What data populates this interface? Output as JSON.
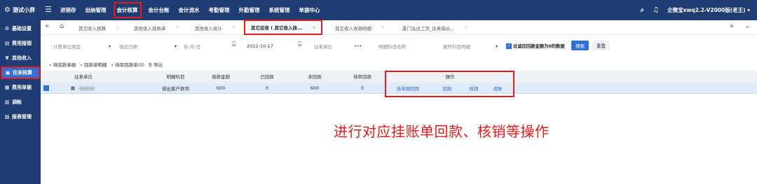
{
  "topbar": {
    "brand": "测试小屏",
    "menu_icon": "☰",
    "nav": [
      "进销存",
      "出纳管理",
      "会计核算",
      "会计台账",
      "会计流水",
      "考勤管理",
      "外勤管理",
      "系统管理",
      "单据中心"
    ],
    "search_icon": "⌕",
    "bell_icon": "♫",
    "user": "企微宝xwq2.2-V2000版(老王)",
    "user_arrow": "▾"
  },
  "sidebar": {
    "items": [
      {
        "icon": "⚙",
        "label": "基础设置"
      },
      {
        "icon": "▤",
        "label": "费用报销"
      },
      {
        "icon": "¥",
        "label": "其他收入"
      },
      {
        "icon": "▣",
        "label": "往来核算"
      },
      {
        "icon": "▦",
        "label": "费用单据"
      },
      {
        "icon": "▥",
        "label": "调帐"
      },
      {
        "icon": "▧",
        "label": "报表管理"
      }
    ]
  },
  "tabs": {
    "prev": "«",
    "home": "⌂",
    "items": [
      "其它收入核算",
      "其他收入挂账单",
      "其他收入统计",
      "其它应收 ( 其它收入挂...",
      "其它收入收款明细",
      "厦门泓达工贸_往来借出..."
    ],
    "close": "×",
    "next": "»",
    "down": "⌄"
  },
  "filters": {
    "unit_type": "计费单位类型",
    "date_type": "借出日期",
    "date_fmt": "年-月-日",
    "date_value": "2022-10-17",
    "unit": "往来单位",
    "dots": "•••",
    "subject": "明细科目名称",
    "show_subject": "展开科目明细",
    "checkbox_label": "过滤应回款金额为0的数据",
    "check": "✓",
    "arrow": "▾",
    "calendar": "⌸",
    "search": "搜索",
    "reset": "重置"
  },
  "actions": {
    "pending_list": "待回款单据",
    "detail": "回款单明细",
    "pending_review": "待审回款单(0)",
    "export": "导出"
  },
  "grid": {
    "headers": [
      "往来单位",
      "明细科目",
      "借款金额",
      "已回款",
      "未回款",
      "待审回款",
      "操作"
    ],
    "row": {
      "subject": "借出客户款项",
      "amount": "600",
      "returned": "0",
      "unreturned": "600",
      "pending": "0",
      "ops": [
        "挂单据回款",
        "回款",
        "核销",
        "调账"
      ]
    }
  },
  "caption": "进行对应挂账单回款、核销等操作"
}
